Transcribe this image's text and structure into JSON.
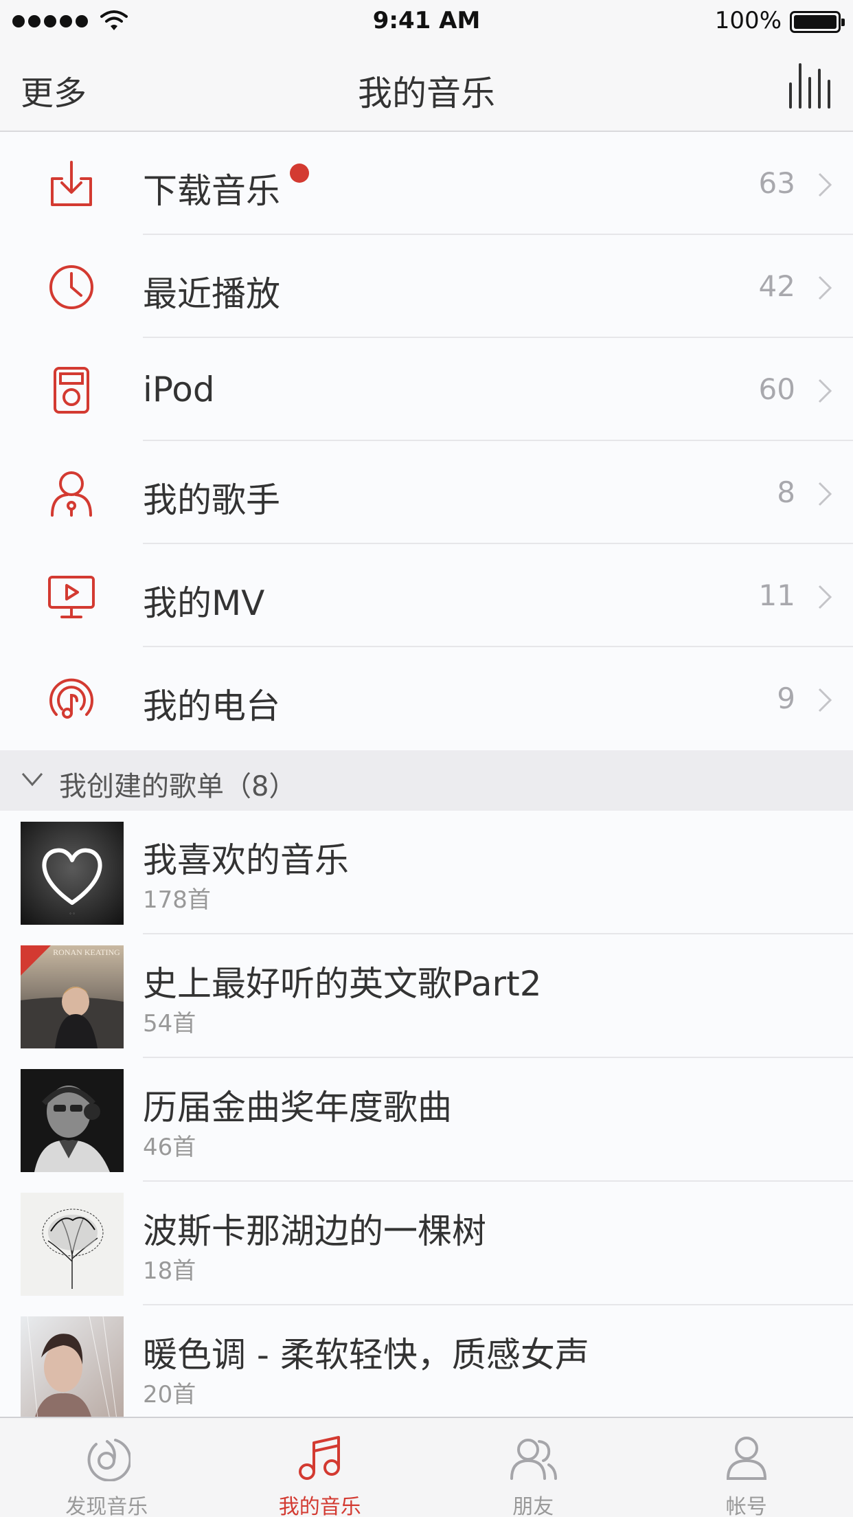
{
  "status_bar": {
    "time": "9:41 AM",
    "battery": "100%"
  },
  "nav": {
    "left": "更多",
    "title": "我的音乐",
    "right_icon": "equalizer-icon"
  },
  "menu": [
    {
      "label": "下载音乐",
      "count": "63",
      "icon": "download-icon",
      "badge": true
    },
    {
      "label": "最近播放",
      "count": "42",
      "icon": "clock-icon",
      "badge": false
    },
    {
      "label": "iPod",
      "count": "60",
      "icon": "ipod-icon",
      "badge": false
    },
    {
      "label": "我的歌手",
      "count": "8",
      "icon": "singer-icon",
      "badge": false
    },
    {
      "label": "我的MV",
      "count": "11",
      "icon": "mv-icon",
      "badge": false
    },
    {
      "label": "我的电台",
      "count": "9",
      "icon": "radio-icon",
      "badge": false
    }
  ],
  "section": {
    "title": "我创建的歌单（8）"
  },
  "playlists": [
    {
      "name": "我喜欢的音乐",
      "count": "178首"
    },
    {
      "name": "史上最好听的英文歌Part2",
      "count": "54首",
      "cover_text": "RONAN KEATING"
    },
    {
      "name": "历届金曲奖年度歌曲",
      "count": "46首"
    },
    {
      "name": "波斯卡那湖边的一棵树",
      "count": "18首"
    },
    {
      "name": "暖色调 - 柔软轻快，质感女声",
      "count": "20首"
    }
  ],
  "tabs": [
    {
      "label": "发现音乐",
      "icon": "discover-music-icon",
      "active": false
    },
    {
      "label": "我的音乐",
      "icon": "music-note-icon",
      "active": true
    },
    {
      "label": "朋友",
      "icon": "friends-icon",
      "active": false
    },
    {
      "label": "帐号",
      "icon": "account-icon",
      "active": false
    }
  ],
  "colors": {
    "accent": "#d33a31",
    "muted": "#a8a8ad"
  }
}
